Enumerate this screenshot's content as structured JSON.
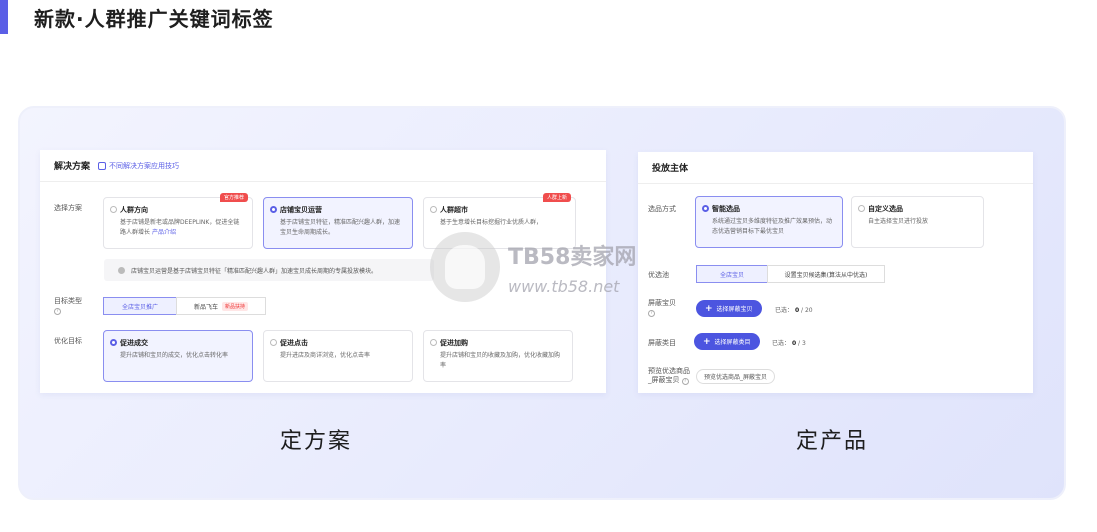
{
  "heading": {
    "title": "新款·人群推广关键词标签"
  },
  "left": {
    "title": "解决方案",
    "link": "不同解决方案应用技巧",
    "plan_label": "选择方案",
    "plans": [
      {
        "title": "人群方向",
        "desc": "基于店铺是新老或品牌DEEPLINK，促进全链路人群增长",
        "desc_link": "产品介绍",
        "tag": "官方推荐"
      },
      {
        "title": "店铺宝贝运营",
        "desc": "基于店铺宝贝特征，精准匹配兴趣人群，加速宝贝生命周期成长。",
        "tag": ""
      },
      {
        "title": "人群超市",
        "desc": "基于生意增长目标挖掘行业优质人群，",
        "tag": "人群上新"
      }
    ],
    "tip": "店铺宝贝运营是基于店铺宝贝特征「精准匹配兴趣人群」加速宝贝成长周期的专属投放模块。",
    "target_label": "目标类型",
    "targets": [
      {
        "label": "全店宝贝推广"
      },
      {
        "label": "新品飞车",
        "tag": "新品扶持"
      }
    ],
    "goal_label": "优化目标",
    "goals": [
      {
        "title": "促进成交",
        "desc": "提升店铺和宝贝的成交，优化点击转化率"
      },
      {
        "title": "促进点击",
        "desc": "提升进店及商详浏览，优化点击率"
      },
      {
        "title": "促进加购",
        "desc": "提升店铺和宝贝的收藏及加购，优化收藏加购率"
      }
    ]
  },
  "right": {
    "title": "投放主体",
    "method_label": "选品方式",
    "methods": [
      {
        "title": "智能选品",
        "desc": "系统通过宝贝多维度特征及推广效果预估，动态优选营销目标下最优宝贝"
      },
      {
        "title": "自定义选品",
        "desc": "自主选择宝贝进行投放"
      }
    ],
    "pool_label": "优选池",
    "pool_options": [
      "全店宝贝",
      "设置宝贝候选集(算法从中优选)"
    ],
    "shield_item_label": "屏蔽宝贝",
    "shield_item_btn": "选择屏蔽宝贝",
    "shield_item_selected": "已选：",
    "shield_item_count": "0",
    "shield_item_total": "/ 20",
    "shield_cat_label": "屏蔽类目",
    "shield_cat_btn": "选择屏蔽类目",
    "shield_cat_selected": "已选：",
    "shield_cat_count": "0",
    "shield_cat_total": "/ 3",
    "preview_label": "预览优选商品_屏蔽宝贝",
    "preview_btn": "预览优选商品_屏蔽宝贝"
  },
  "captions": {
    "left": "定方案",
    "right": "定产品"
  },
  "watermark": {
    "cn": "TB58卖家网",
    "url": "www.tb58.net"
  }
}
